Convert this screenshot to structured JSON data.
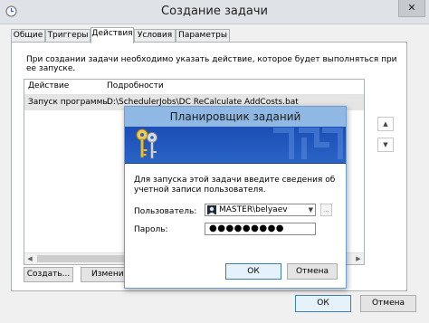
{
  "window": {
    "title": "Создание задачи",
    "close_glyph": "✕"
  },
  "tabs": [
    {
      "label": "Общие"
    },
    {
      "label": "Триггеры"
    },
    {
      "label": "Действия",
      "active": true
    },
    {
      "label": "Условия"
    },
    {
      "label": "Параметры"
    }
  ],
  "actions_tab": {
    "description": "При создании задачи необходимо указать действие, которое будет выполняться при ее запуске.",
    "columns": [
      "Действие",
      "Подробности"
    ],
    "rows": [
      {
        "action": "Запуск программы",
        "details": "D:\\SchedulerJobs\\DC ReCalculate AddCosts.bat"
      }
    ],
    "buttons": {
      "create": "Создать...",
      "edit": "Изменит"
    }
  },
  "footer": {
    "ok": "ОК",
    "cancel": "Отмена"
  },
  "credentials_dialog": {
    "title": "Планировщик заданий",
    "prompt": "Для запуска этой задачи введите сведения об учетной записи пользователя.",
    "user_label": "Пользователь:",
    "user_value": "MASTER\\belyaev",
    "browse_label": "...",
    "password_label": "Пароль:",
    "password_mask": "●●●●●●●●●",
    "ok": "ОК",
    "cancel": "Отмена"
  },
  "colors": {
    "dialog_banner": "#1c4eb5",
    "dialog_title_bar": "#8fb9e4",
    "primary_button_border": "#3c7fb1",
    "list_selection": "#e5e5e5"
  },
  "icons": {
    "window": "task-scheduler-clock-icon",
    "dialog": "keys-icon",
    "user": "user-avatar-icon"
  }
}
